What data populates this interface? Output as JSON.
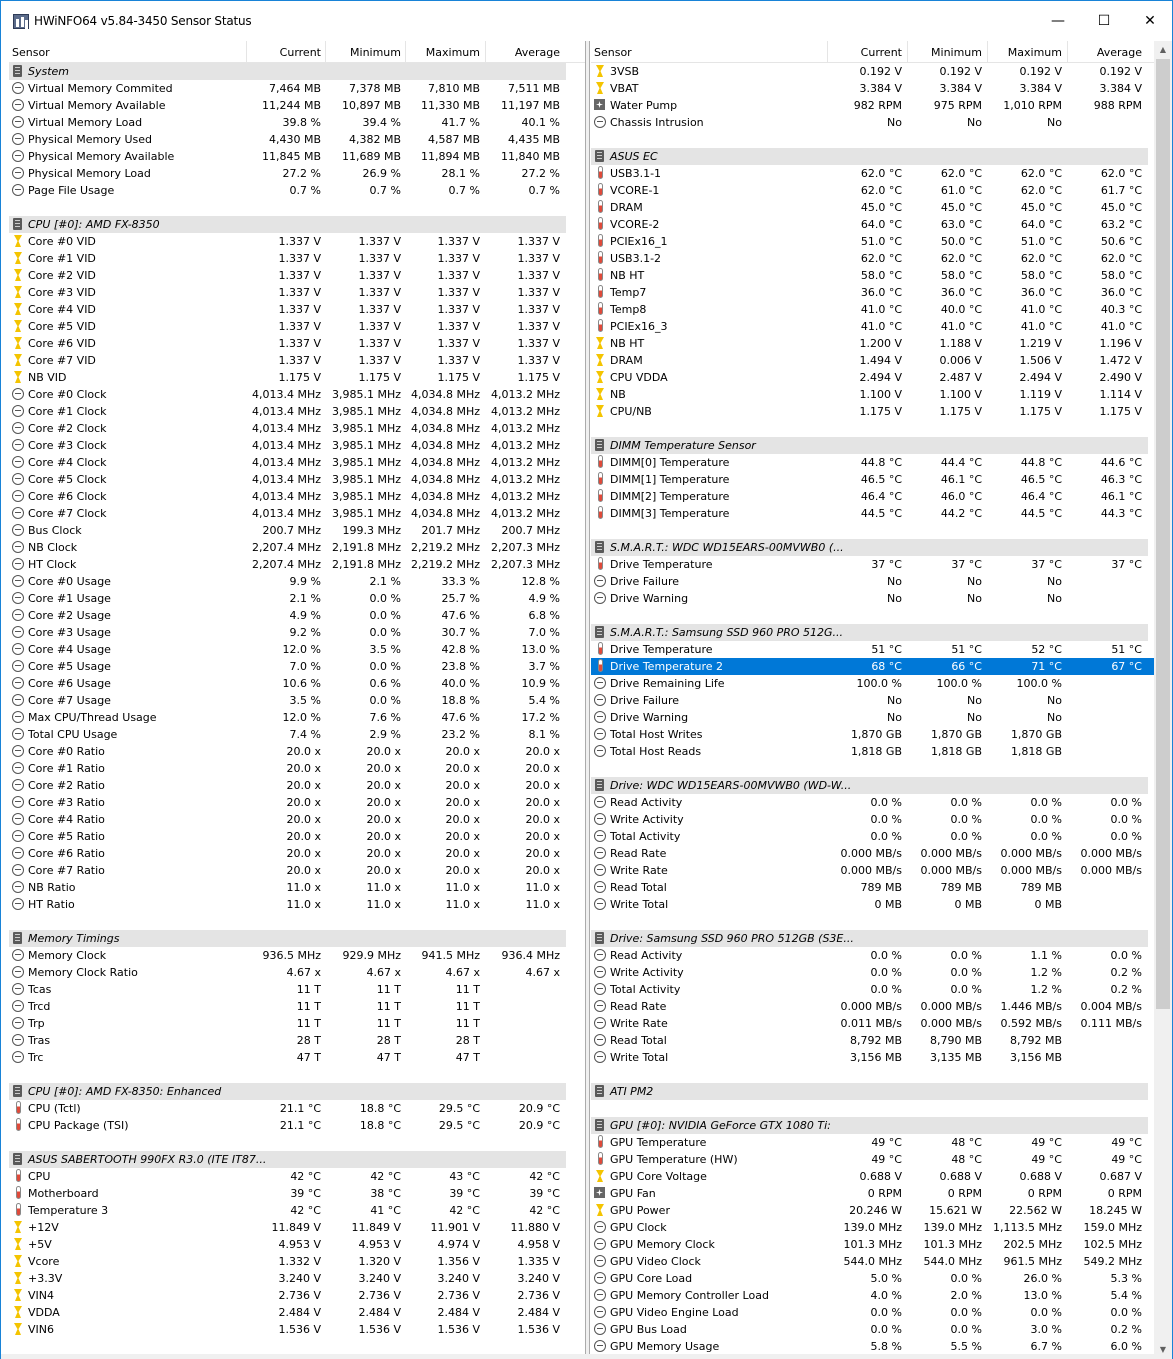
{
  "window": {
    "title": "HWiNFO64 v5.84-3450 Sensor Status",
    "min": "—",
    "max": "☐",
    "close": "✕"
  },
  "columns": [
    "Sensor",
    "Current",
    "Minimum",
    "Maximum",
    "Average"
  ],
  "left": [
    [
      "g",
      "System",
      "",
      "",
      "",
      ""
    ],
    [
      "c",
      "Virtual Memory Commited",
      "7,464 MB",
      "7,378 MB",
      "7,810 MB",
      "7,511 MB"
    ],
    [
      "c",
      "Virtual Memory Available",
      "11,244 MB",
      "10,897 MB",
      "11,330 MB",
      "11,197 MB"
    ],
    [
      "c",
      "Virtual Memory Load",
      "39.8 %",
      "39.4 %",
      "41.7 %",
      "40.1 %"
    ],
    [
      "c",
      "Physical Memory Used",
      "4,430 MB",
      "4,382 MB",
      "4,587 MB",
      "4,435 MB"
    ],
    [
      "c",
      "Physical Memory Available",
      "11,845 MB",
      "11,689 MB",
      "11,894 MB",
      "11,840 MB"
    ],
    [
      "c",
      "Physical Memory Load",
      "27.2 %",
      "26.9 %",
      "28.1 %",
      "27.2 %"
    ],
    [
      "c",
      "Page File Usage",
      "0.7 %",
      "0.7 %",
      "0.7 %",
      "0.7 %"
    ],
    [
      "e",
      "",
      "",
      "",
      "",
      ""
    ],
    [
      "g",
      "CPU [#0]: AMD FX-8350",
      "",
      "",
      "",
      ""
    ],
    [
      "v",
      "Core #0 VID",
      "1.337 V",
      "1.337 V",
      "1.337 V",
      "1.337 V"
    ],
    [
      "v",
      "Core #1 VID",
      "1.337 V",
      "1.337 V",
      "1.337 V",
      "1.337 V"
    ],
    [
      "v",
      "Core #2 VID",
      "1.337 V",
      "1.337 V",
      "1.337 V",
      "1.337 V"
    ],
    [
      "v",
      "Core #3 VID",
      "1.337 V",
      "1.337 V",
      "1.337 V",
      "1.337 V"
    ],
    [
      "v",
      "Core #4 VID",
      "1.337 V",
      "1.337 V",
      "1.337 V",
      "1.337 V"
    ],
    [
      "v",
      "Core #5 VID",
      "1.337 V",
      "1.337 V",
      "1.337 V",
      "1.337 V"
    ],
    [
      "v",
      "Core #6 VID",
      "1.337 V",
      "1.337 V",
      "1.337 V",
      "1.337 V"
    ],
    [
      "v",
      "Core #7 VID",
      "1.337 V",
      "1.337 V",
      "1.337 V",
      "1.337 V"
    ],
    [
      "v",
      "NB VID",
      "1.175 V",
      "1.175 V",
      "1.175 V",
      "1.175 V"
    ],
    [
      "c",
      "Core #0 Clock",
      "4,013.4 MHz",
      "3,985.1 MHz",
      "4,034.8 MHz",
      "4,013.2 MHz"
    ],
    [
      "c",
      "Core #1 Clock",
      "4,013.4 MHz",
      "3,985.1 MHz",
      "4,034.8 MHz",
      "4,013.2 MHz"
    ],
    [
      "c",
      "Core #2 Clock",
      "4,013.4 MHz",
      "3,985.1 MHz",
      "4,034.8 MHz",
      "4,013.2 MHz"
    ],
    [
      "c",
      "Core #3 Clock",
      "4,013.4 MHz",
      "3,985.1 MHz",
      "4,034.8 MHz",
      "4,013.2 MHz"
    ],
    [
      "c",
      "Core #4 Clock",
      "4,013.4 MHz",
      "3,985.1 MHz",
      "4,034.8 MHz",
      "4,013.2 MHz"
    ],
    [
      "c",
      "Core #5 Clock",
      "4,013.4 MHz",
      "3,985.1 MHz",
      "4,034.8 MHz",
      "4,013.2 MHz"
    ],
    [
      "c",
      "Core #6 Clock",
      "4,013.4 MHz",
      "3,985.1 MHz",
      "4,034.8 MHz",
      "4,013.2 MHz"
    ],
    [
      "c",
      "Core #7 Clock",
      "4,013.4 MHz",
      "3,985.1 MHz",
      "4,034.8 MHz",
      "4,013.2 MHz"
    ],
    [
      "c",
      "Bus Clock",
      "200.7 MHz",
      "199.3 MHz",
      "201.7 MHz",
      "200.7 MHz"
    ],
    [
      "c",
      "NB Clock",
      "2,207.4 MHz",
      "2,191.8 MHz",
      "2,219.2 MHz",
      "2,207.3 MHz"
    ],
    [
      "c",
      "HT Clock",
      "2,207.4 MHz",
      "2,191.8 MHz",
      "2,219.2 MHz",
      "2,207.3 MHz"
    ],
    [
      "c",
      "Core #0 Usage",
      "9.9 %",
      "2.1 %",
      "33.3 %",
      "12.8 %"
    ],
    [
      "c",
      "Core #1 Usage",
      "2.1 %",
      "0.0 %",
      "25.7 %",
      "4.9 %"
    ],
    [
      "c",
      "Core #2 Usage",
      "4.9 %",
      "0.0 %",
      "47.6 %",
      "6.8 %"
    ],
    [
      "c",
      "Core #3 Usage",
      "9.2 %",
      "0.0 %",
      "30.7 %",
      "7.0 %"
    ],
    [
      "c",
      "Core #4 Usage",
      "12.0 %",
      "3.5 %",
      "42.8 %",
      "13.0 %"
    ],
    [
      "c",
      "Core #5 Usage",
      "7.0 %",
      "0.0 %",
      "23.8 %",
      "3.7 %"
    ],
    [
      "c",
      "Core #6 Usage",
      "10.6 %",
      "0.6 %",
      "40.0 %",
      "10.9 %"
    ],
    [
      "c",
      "Core #7 Usage",
      "3.5 %",
      "0.0 %",
      "18.8 %",
      "5.4 %"
    ],
    [
      "c",
      "Max CPU/Thread Usage",
      "12.0 %",
      "7.6 %",
      "47.6 %",
      "17.2 %"
    ],
    [
      "c",
      "Total CPU Usage",
      "7.4 %",
      "2.9 %",
      "23.2 %",
      "8.1 %"
    ],
    [
      "c",
      "Core #0 Ratio",
      "20.0 x",
      "20.0 x",
      "20.0 x",
      "20.0 x"
    ],
    [
      "c",
      "Core #1 Ratio",
      "20.0 x",
      "20.0 x",
      "20.0 x",
      "20.0 x"
    ],
    [
      "c",
      "Core #2 Ratio",
      "20.0 x",
      "20.0 x",
      "20.0 x",
      "20.0 x"
    ],
    [
      "c",
      "Core #3 Ratio",
      "20.0 x",
      "20.0 x",
      "20.0 x",
      "20.0 x"
    ],
    [
      "c",
      "Core #4 Ratio",
      "20.0 x",
      "20.0 x",
      "20.0 x",
      "20.0 x"
    ],
    [
      "c",
      "Core #5 Ratio",
      "20.0 x",
      "20.0 x",
      "20.0 x",
      "20.0 x"
    ],
    [
      "c",
      "Core #6 Ratio",
      "20.0 x",
      "20.0 x",
      "20.0 x",
      "20.0 x"
    ],
    [
      "c",
      "Core #7 Ratio",
      "20.0 x",
      "20.0 x",
      "20.0 x",
      "20.0 x"
    ],
    [
      "c",
      "NB Ratio",
      "11.0 x",
      "11.0 x",
      "11.0 x",
      "11.0 x"
    ],
    [
      "c",
      "HT Ratio",
      "11.0 x",
      "11.0 x",
      "11.0 x",
      "11.0 x"
    ],
    [
      "e",
      "",
      "",
      "",
      "",
      ""
    ],
    [
      "g",
      "Memory Timings",
      "",
      "",
      "",
      ""
    ],
    [
      "c",
      "Memory Clock",
      "936.5 MHz",
      "929.9 MHz",
      "941.5 MHz",
      "936.4 MHz"
    ],
    [
      "c",
      "Memory Clock Ratio",
      "4.67 x",
      "4.67 x",
      "4.67 x",
      "4.67 x"
    ],
    [
      "c",
      "Tcas",
      "11 T",
      "11 T",
      "11 T",
      ""
    ],
    [
      "c",
      "Trcd",
      "11 T",
      "11 T",
      "11 T",
      ""
    ],
    [
      "c",
      "Trp",
      "11 T",
      "11 T",
      "11 T",
      ""
    ],
    [
      "c",
      "Tras",
      "28 T",
      "28 T",
      "28 T",
      ""
    ],
    [
      "c",
      "Trc",
      "47 T",
      "47 T",
      "47 T",
      ""
    ],
    [
      "e",
      "",
      "",
      "",
      "",
      ""
    ],
    [
      "g",
      "CPU [#0]: AMD FX-8350: Enhanced",
      "",
      "",
      "",
      ""
    ],
    [
      "t",
      "CPU (Tctl)",
      "21.1 °C",
      "18.8 °C",
      "29.5 °C",
      "20.9 °C"
    ],
    [
      "t",
      "CPU Package (TSI)",
      "21.1 °C",
      "18.8 °C",
      "29.5 °C",
      "20.9 °C"
    ],
    [
      "e",
      "",
      "",
      "",
      "",
      ""
    ],
    [
      "g",
      "ASUS SABERTOOTH 990FX R3.0 (ITE IT87...",
      "",
      "",
      "",
      ""
    ],
    [
      "t",
      "CPU",
      "42 °C",
      "42 °C",
      "43 °C",
      "42 °C"
    ],
    [
      "t",
      "Motherboard",
      "39 °C",
      "38 °C",
      "39 °C",
      "39 °C"
    ],
    [
      "t",
      "Temperature 3",
      "42 °C",
      "41 °C",
      "42 °C",
      "42 °C"
    ],
    [
      "v",
      "+12V",
      "11.849 V",
      "11.849 V",
      "11.901 V",
      "11.880 V"
    ],
    [
      "v",
      "+5V",
      "4.953 V",
      "4.953 V",
      "4.974 V",
      "4.958 V"
    ],
    [
      "v",
      "Vcore",
      "1.332 V",
      "1.320 V",
      "1.356 V",
      "1.335 V"
    ],
    [
      "v",
      "+3.3V",
      "3.240 V",
      "3.240 V",
      "3.240 V",
      "3.240 V"
    ],
    [
      "v",
      "VIN4",
      "2.736 V",
      "2.736 V",
      "2.736 V",
      "2.736 V"
    ],
    [
      "v",
      "VDDA",
      "2.484 V",
      "2.484 V",
      "2.484 V",
      "2.484 V"
    ],
    [
      "v",
      "VIN6",
      "1.536 V",
      "1.536 V",
      "1.536 V",
      "1.536 V"
    ]
  ],
  "right": [
    [
      "v",
      "3VSB",
      "0.192 V",
      "0.192 V",
      "0.192 V",
      "0.192 V"
    ],
    [
      "v",
      "VBAT",
      "3.384 V",
      "3.384 V",
      "3.384 V",
      "3.384 V"
    ],
    [
      "f",
      "Water Pump",
      "982 RPM",
      "975 RPM",
      "1,010 RPM",
      "988 RPM"
    ],
    [
      "c",
      "Chassis Intrusion",
      "No",
      "No",
      "No",
      ""
    ],
    [
      "e",
      "",
      "",
      "",
      "",
      ""
    ],
    [
      "g",
      "ASUS EC",
      "",
      "",
      "",
      ""
    ],
    [
      "t",
      "USB3.1-1",
      "62.0 °C",
      "62.0 °C",
      "62.0 °C",
      "62.0 °C"
    ],
    [
      "t",
      "VCORE-1",
      "62.0 °C",
      "61.0 °C",
      "62.0 °C",
      "61.7 °C"
    ],
    [
      "t",
      "DRAM",
      "45.0 °C",
      "45.0 °C",
      "45.0 °C",
      "45.0 °C"
    ],
    [
      "t",
      "VCORE-2",
      "64.0 °C",
      "63.0 °C",
      "64.0 °C",
      "63.2 °C"
    ],
    [
      "t",
      "PCIEx16_1",
      "51.0 °C",
      "50.0 °C",
      "51.0 °C",
      "50.6 °C"
    ],
    [
      "t",
      "USB3.1-2",
      "62.0 °C",
      "62.0 °C",
      "62.0 °C",
      "62.0 °C"
    ],
    [
      "t",
      "NB HT",
      "58.0 °C",
      "58.0 °C",
      "58.0 °C",
      "58.0 °C"
    ],
    [
      "t",
      "Temp7",
      "36.0 °C",
      "36.0 °C",
      "36.0 °C",
      "36.0 °C"
    ],
    [
      "t",
      "Temp8",
      "41.0 °C",
      "40.0 °C",
      "41.0 °C",
      "40.3 °C"
    ],
    [
      "t",
      "PCIEx16_3",
      "41.0 °C",
      "41.0 °C",
      "41.0 °C",
      "41.0 °C"
    ],
    [
      "v",
      "NB HT",
      "1.200 V",
      "1.188 V",
      "1.219 V",
      "1.196 V"
    ],
    [
      "v",
      "DRAM",
      "1.494 V",
      "0.006 V",
      "1.506 V",
      "1.472 V"
    ],
    [
      "v",
      "CPU VDDA",
      "2.494 V",
      "2.487 V",
      "2.494 V",
      "2.490 V"
    ],
    [
      "v",
      "NB",
      "1.100 V",
      "1.100 V",
      "1.119 V",
      "1.114 V"
    ],
    [
      "v",
      "CPU/NB",
      "1.175 V",
      "1.175 V",
      "1.175 V",
      "1.175 V"
    ],
    [
      "e",
      "",
      "",
      "",
      "",
      ""
    ],
    [
      "g",
      "DIMM Temperature Sensor",
      "",
      "",
      "",
      ""
    ],
    [
      "t",
      "DIMM[0] Temperature",
      "44.8 °C",
      "44.4 °C",
      "44.8 °C",
      "44.6 °C"
    ],
    [
      "t",
      "DIMM[1] Temperature",
      "46.5 °C",
      "46.1 °C",
      "46.5 °C",
      "46.3 °C"
    ],
    [
      "t",
      "DIMM[2] Temperature",
      "46.4 °C",
      "46.0 °C",
      "46.4 °C",
      "46.1 °C"
    ],
    [
      "t",
      "DIMM[3] Temperature",
      "44.5 °C",
      "44.2 °C",
      "44.5 °C",
      "44.3 °C"
    ],
    [
      "e",
      "",
      "",
      "",
      "",
      ""
    ],
    [
      "g",
      "S.M.A.R.T.: WDC WD15EARS-00MVWB0 (...",
      "",
      "",
      "",
      ""
    ],
    [
      "t",
      "Drive Temperature",
      "37 °C",
      "37 °C",
      "37 °C",
      "37 °C"
    ],
    [
      "c",
      "Drive Failure",
      "No",
      "No",
      "No",
      ""
    ],
    [
      "c",
      "Drive Warning",
      "No",
      "No",
      "No",
      ""
    ],
    [
      "e",
      "",
      "",
      "",
      "",
      ""
    ],
    [
      "g",
      "S.M.A.R.T.: Samsung SSD 960 PRO 512G...",
      "",
      "",
      "",
      ""
    ],
    [
      "t",
      "Drive Temperature",
      "51 °C",
      "51 °C",
      "52 °C",
      "51 °C"
    ],
    [
      "s",
      "Drive Temperature 2",
      "68 °C",
      "66 °C",
      "71 °C",
      "67 °C"
    ],
    [
      "c",
      "Drive Remaining Life",
      "100.0 %",
      "100.0 %",
      "100.0 %",
      ""
    ],
    [
      "c",
      "Drive Failure",
      "No",
      "No",
      "No",
      ""
    ],
    [
      "c",
      "Drive Warning",
      "No",
      "No",
      "No",
      ""
    ],
    [
      "c",
      "Total Host Writes",
      "1,870 GB",
      "1,870 GB",
      "1,870 GB",
      ""
    ],
    [
      "c",
      "Total Host Reads",
      "1,818 GB",
      "1,818 GB",
      "1,818 GB",
      ""
    ],
    [
      "e",
      "",
      "",
      "",
      "",
      ""
    ],
    [
      "g",
      "Drive: WDC WD15EARS-00MVWB0 (WD-W...",
      "",
      "",
      "",
      ""
    ],
    [
      "c",
      "Read Activity",
      "0.0 %",
      "0.0 %",
      "0.0 %",
      "0.0 %"
    ],
    [
      "c",
      "Write Activity",
      "0.0 %",
      "0.0 %",
      "0.0 %",
      "0.0 %"
    ],
    [
      "c",
      "Total Activity",
      "0.0 %",
      "0.0 %",
      "0.0 %",
      "0.0 %"
    ],
    [
      "c",
      "Read Rate",
      "0.000 MB/s",
      "0.000 MB/s",
      "0.000 MB/s",
      "0.000 MB/s"
    ],
    [
      "c",
      "Write Rate",
      "0.000 MB/s",
      "0.000 MB/s",
      "0.000 MB/s",
      "0.000 MB/s"
    ],
    [
      "c",
      "Read Total",
      "789 MB",
      "789 MB",
      "789 MB",
      ""
    ],
    [
      "c",
      "Write Total",
      "0 MB",
      "0 MB",
      "0 MB",
      ""
    ],
    [
      "e",
      "",
      "",
      "",
      "",
      ""
    ],
    [
      "g",
      "Drive: Samsung SSD 960 PRO 512GB (S3E...",
      "",
      "",
      "",
      ""
    ],
    [
      "c",
      "Read Activity",
      "0.0 %",
      "0.0 %",
      "1.1 %",
      "0.0 %"
    ],
    [
      "c",
      "Write Activity",
      "0.0 %",
      "0.0 %",
      "1.2 %",
      "0.2 %"
    ],
    [
      "c",
      "Total Activity",
      "0.0 %",
      "0.0 %",
      "1.2 %",
      "0.2 %"
    ],
    [
      "c",
      "Read Rate",
      "0.000 MB/s",
      "0.000 MB/s",
      "1.446 MB/s",
      "0.004 MB/s"
    ],
    [
      "c",
      "Write Rate",
      "0.011 MB/s",
      "0.000 MB/s",
      "0.592 MB/s",
      "0.111 MB/s"
    ],
    [
      "c",
      "Read Total",
      "8,792 MB",
      "8,790 MB",
      "8,792 MB",
      ""
    ],
    [
      "c",
      "Write Total",
      "3,156 MB",
      "3,135 MB",
      "3,156 MB",
      ""
    ],
    [
      "e",
      "",
      "",
      "",
      "",
      ""
    ],
    [
      "g",
      "ATI PM2",
      "",
      "",
      "",
      ""
    ],
    [
      "e",
      "",
      "",
      "",
      "",
      ""
    ],
    [
      "g",
      "GPU [#0]: NVIDIA GeForce GTX 1080 Ti:",
      "",
      "",
      "",
      ""
    ],
    [
      "t",
      "GPU Temperature",
      "49 °C",
      "48 °C",
      "49 °C",
      "49 °C"
    ],
    [
      "t",
      "GPU Temperature (HW)",
      "49 °C",
      "48 °C",
      "49 °C",
      "49 °C"
    ],
    [
      "v",
      "GPU Core Voltage",
      "0.688 V",
      "0.688 V",
      "0.688 V",
      "0.687 V"
    ],
    [
      "f",
      "GPU Fan",
      "0 RPM",
      "0 RPM",
      "0 RPM",
      "0 RPM"
    ],
    [
      "v",
      "GPU Power",
      "20.246 W",
      "15.621 W",
      "22.562 W",
      "18.245 W"
    ],
    [
      "c",
      "GPU Clock",
      "139.0 MHz",
      "139.0 MHz",
      "1,113.5 MHz",
      "159.0 MHz"
    ],
    [
      "c",
      "GPU Memory Clock",
      "101.3 MHz",
      "101.3 MHz",
      "202.5 MHz",
      "102.5 MHz"
    ],
    [
      "c",
      "GPU Video Clock",
      "544.0 MHz",
      "544.0 MHz",
      "961.5 MHz",
      "549.2 MHz"
    ],
    [
      "c",
      "GPU Core Load",
      "5.0 %",
      "0.0 %",
      "26.0 %",
      "5.3 %"
    ],
    [
      "c",
      "GPU Memory Controller Load",
      "4.0 %",
      "2.0 %",
      "13.0 %",
      "5.4 %"
    ],
    [
      "c",
      "GPU Video Engine Load",
      "0.0 %",
      "0.0 %",
      "0.0 %",
      "0.0 %"
    ],
    [
      "c",
      "GPU Bus Load",
      "0.0 %",
      "0.0 %",
      "3.0 %",
      "0.2 %"
    ],
    [
      "c",
      "GPU Memory Usage",
      "5.8 %",
      "5.5 %",
      "6.7 %",
      "6.0 %"
    ]
  ],
  "scrollbar": {
    "up": "▲",
    "down": "▼"
  }
}
